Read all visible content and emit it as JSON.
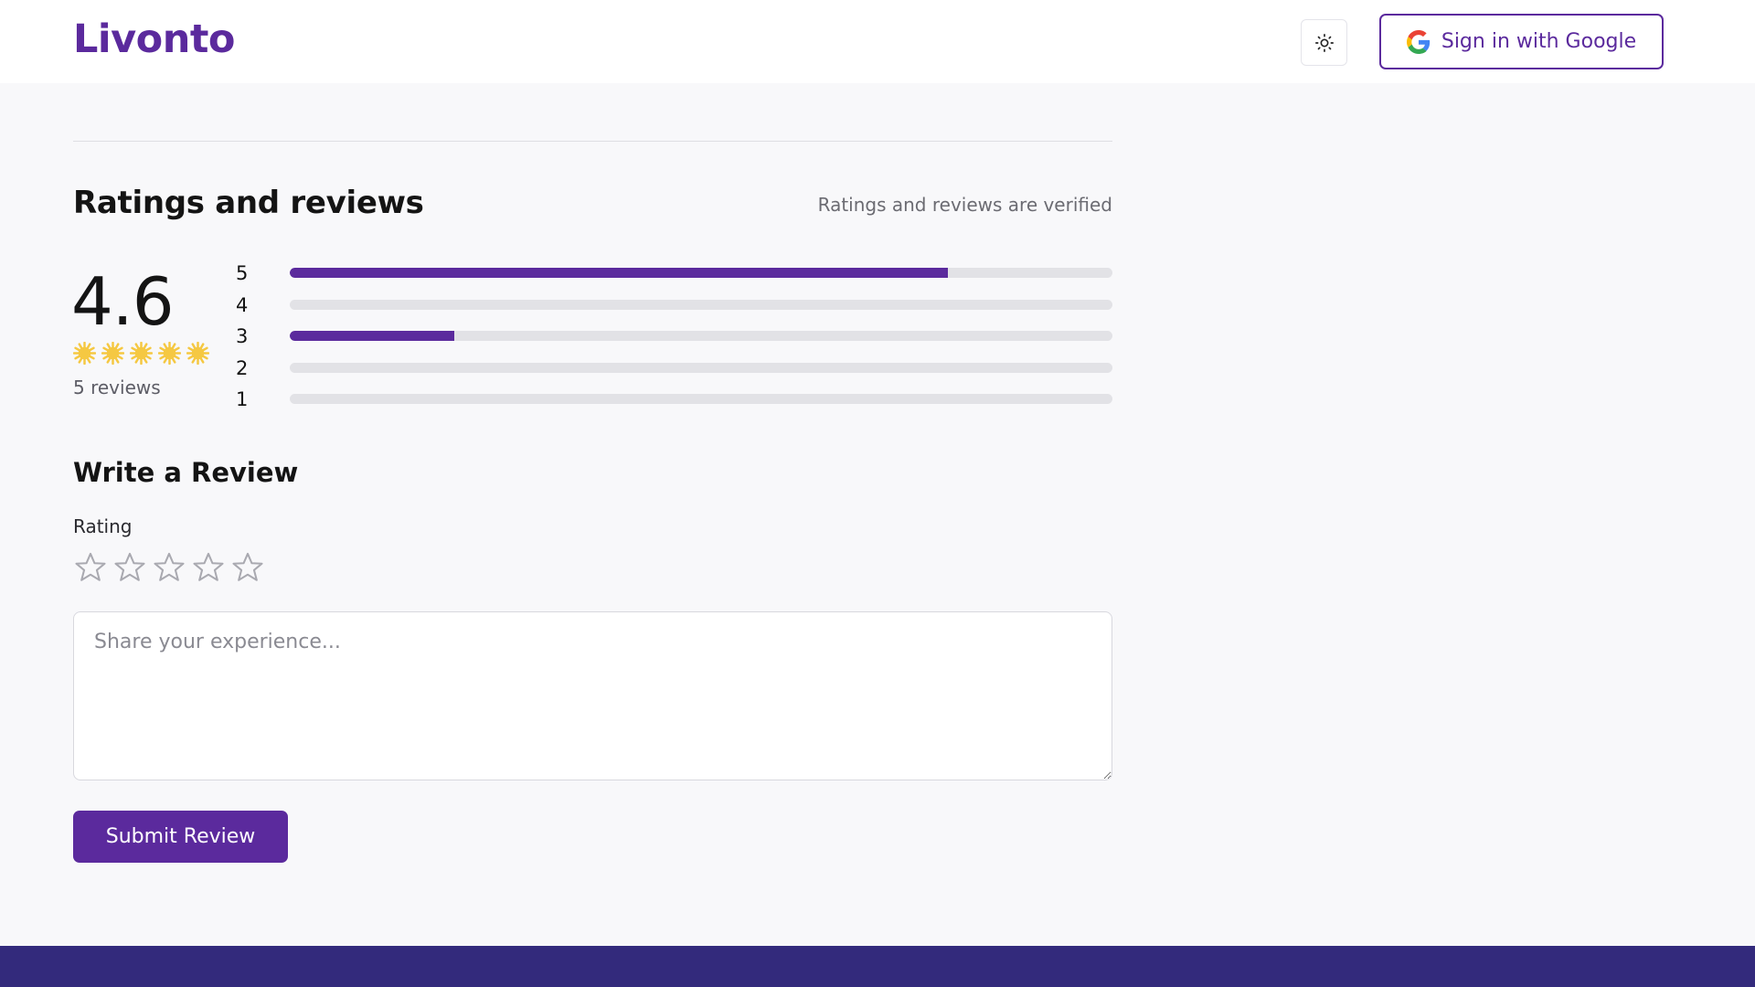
{
  "header": {
    "logo": "Livonto",
    "theme_toggle_icon": "sun-icon",
    "google_button_label": "Sign in with Google",
    "google_icon": "google-g-icon"
  },
  "ratings": {
    "title": "Ratings and reviews",
    "verified_note": "Ratings and reviews are verified",
    "average": "4.6",
    "average_stars": 5,
    "reviews_count": "5 reviews",
    "distribution": [
      {
        "stars": "5",
        "fraction": 0.8
      },
      {
        "stars": "4",
        "fraction": 0
      },
      {
        "stars": "3",
        "fraction": 0.2
      },
      {
        "stars": "2",
        "fraction": 0
      },
      {
        "stars": "1",
        "fraction": 0
      }
    ]
  },
  "write_review": {
    "title": "Write a Review",
    "rating_label": "Rating",
    "star_count": 5,
    "textarea_placeholder": "Share your experience...",
    "textarea_value": "",
    "submit_label": "Submit Review"
  },
  "colors": {
    "brand": "#5b2a9d",
    "footer": "#332a7c",
    "star_fill": "#f5c842"
  }
}
